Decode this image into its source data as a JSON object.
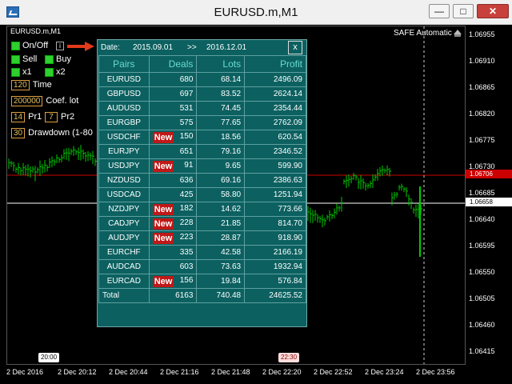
{
  "window": {
    "title": "EURUSD.m,M1"
  },
  "chart": {
    "symbol_label": "EURUSD.m,M1",
    "safe_label": "SAFE Automatic",
    "colors": {
      "bid_line": "#cc0000",
      "ask_line": "#ffffff",
      "bars": "#00cc00",
      "panel": "#0c6060"
    }
  },
  "controls": {
    "onoff": "On/Off",
    "info_label": "i",
    "sell": "Sell",
    "buy": "Buy",
    "x1": "x1",
    "x2": "x2",
    "time_value": "120",
    "time_label": "Time",
    "coef_value": "200000",
    "coef_label": "Coef. lot",
    "pr1_value": "14",
    "pr1_label": "Pr1",
    "pr2_value": "7",
    "pr2_label": "Pr2",
    "drawdown_value": "30",
    "drawdown_label": "Drawdown (1-80"
  },
  "panel": {
    "date_label": "Date:",
    "date_from": "2015.09.01",
    "separator": ">>",
    "date_to": "2016.12.01",
    "close_label": "x",
    "headers": [
      "Pairs",
      "Deals",
      "Lots",
      "Profit"
    ],
    "new_label": "New",
    "rows": [
      {
        "pair": "EURUSD",
        "new": false,
        "deals": "680",
        "lots": "68.14",
        "profit": "2496.09"
      },
      {
        "pair": "GBPUSD",
        "new": false,
        "deals": "697",
        "lots": "83.52",
        "profit": "2624.14"
      },
      {
        "pair": "AUDUSD",
        "new": false,
        "deals": "531",
        "lots": "74.45",
        "profit": "2354.44"
      },
      {
        "pair": "EURGBP",
        "new": false,
        "deals": "575",
        "lots": "77.65",
        "profit": "2762.09"
      },
      {
        "pair": "USDCHF",
        "new": true,
        "deals": "150",
        "lots": "18.56",
        "profit": "620.54"
      },
      {
        "pair": "EURJPY",
        "new": false,
        "deals": "651",
        "lots": "79.16",
        "profit": "2346.52"
      },
      {
        "pair": "USDJPY",
        "new": true,
        "deals": "91",
        "lots": "9.65",
        "profit": "599.90"
      },
      {
        "pair": "NZDUSD",
        "new": false,
        "deals": "636",
        "lots": "69.16",
        "profit": "2386.63"
      },
      {
        "pair": "USDCAD",
        "new": false,
        "deals": "425",
        "lots": "58.80",
        "profit": "1251.94"
      },
      {
        "pair": "NZDJPY",
        "new": true,
        "deals": "182",
        "lots": "14.62",
        "profit": "773.66"
      },
      {
        "pair": "CADJPY",
        "new": true,
        "deals": "228",
        "lots": "21.85",
        "profit": "814.70"
      },
      {
        "pair": "AUDJPY",
        "new": true,
        "deals": "223",
        "lots": "28.87",
        "profit": "918.90"
      },
      {
        "pair": "EURCHF",
        "new": false,
        "deals": "335",
        "lots": "42.58",
        "profit": "2166.19"
      },
      {
        "pair": "AUDCAD",
        "new": false,
        "deals": "603",
        "lots": "73.63",
        "profit": "1932.94"
      },
      {
        "pair": "EURCAD",
        "new": true,
        "deals": "156",
        "lots": "19.84",
        "profit": "576.84"
      }
    ],
    "total": {
      "label": "Total",
      "deals": "6163",
      "lots": "740.48",
      "profit": "24625.52"
    }
  },
  "price_scale": [
    "1.06955",
    "1.06910",
    "1.06865",
    "1.06820",
    "1.06775",
    "1.06730",
    "1.06685",
    "1.06640",
    "1.06595",
    "1.06550",
    "1.06505",
    "1.06460",
    "1.06415"
  ],
  "price_tags": {
    "bid": "1.06706",
    "ask": "1.06658"
  },
  "time_scale": [
    "2 Dec 2016",
    "2 Dec 20:12",
    "2 Dec 20:44",
    "2 Dec 21:16",
    "2 Dec 21:48",
    "2 Dec 22:20",
    "2 Dec 22:52",
    "2 Dec 23:24",
    "2 Dec 23:56"
  ],
  "time_tags": [
    "20:00",
    "22:30"
  ]
}
